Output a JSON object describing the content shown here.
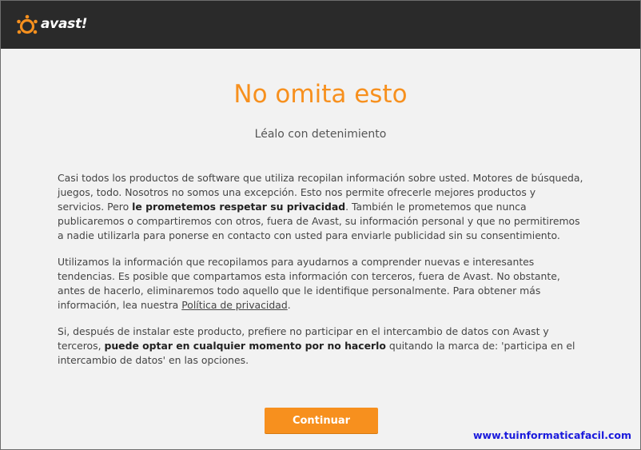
{
  "app": {
    "brand": "avast!",
    "logo_icon": "avast-logo-icon",
    "accent_color": "#f7901e"
  },
  "header": {
    "title": "No omita esto",
    "subtitle": "Léalo con detenimiento"
  },
  "paragraphs": {
    "p1_a": "Casi todos los productos de software que utiliza recopilan información sobre usted. Motores de búsqueda, juegos, todo. Nosotros no somos una excepción. Esto nos permite ofrecerle mejores productos y servicios. Pero ",
    "p1_bold": "le prometemos respetar su privacidad",
    "p1_b": ". También le prometemos que nunca publicaremos o compartiremos con otros, fuera de Avast, su información personal y que no permitiremos a nadie utilizarla para ponerse en contacto con usted para enviarle publicidad sin su consentimiento.",
    "p2_a": "Utilizamos la información que recopilamos para ayudarnos a comprender nuevas e interesantes tendencias. Es posible que compartamos esta información con terceros, fuera de Avast. No obstante, antes de hacerlo, eliminaremos todo aquello que le identifique personalmente. Para obtener más información, lea nuestra ",
    "p2_link": "Política de privacidad",
    "p2_b": ".",
    "p3_a": "Si, después de instalar este producto, prefiere no participar en el intercambio de datos con Avast y terceros, ",
    "p3_bold": "puede optar en cualquier momento por no hacerlo",
    "p3_b": " quitando la marca de: 'participa en el intercambio de datos' en las opciones."
  },
  "actions": {
    "continue_label": "Continuar"
  },
  "watermark": {
    "text": "www.tuinformaticafacil.com",
    "color": "#1a1adc"
  }
}
